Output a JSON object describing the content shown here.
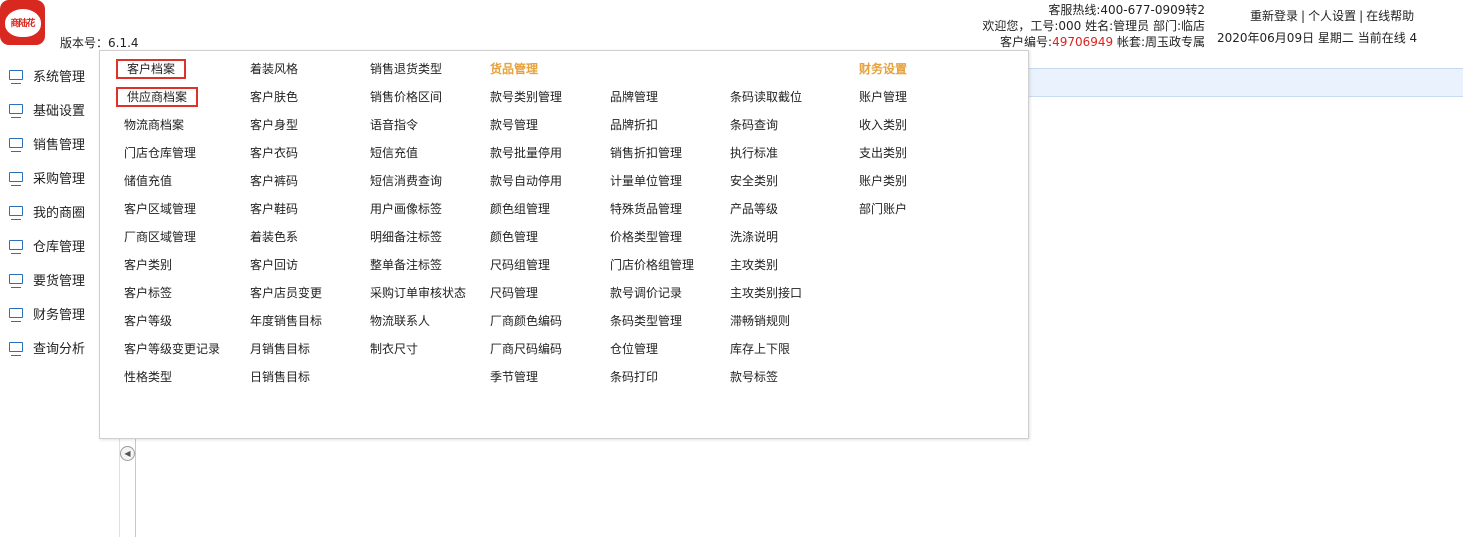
{
  "header": {
    "logo_text": "商陆花",
    "version": "版本号：6.1.4",
    "hotline": "客服热线:400-677-0909转2",
    "welcome": "欢迎您，工号:000 姓名:管理员 部门:临店",
    "customer_label": "客户编号:",
    "customer_no": "49706949",
    "account_set": " 帐套:周玉政专属",
    "links": [
      "重新登录",
      "个人设置",
      "在线帮助"
    ],
    "date_line": "2020年06月09日 星期二 当前在线 4"
  },
  "sidebar": {
    "items": [
      {
        "label": "系统管理"
      },
      {
        "label": "基础设置"
      },
      {
        "label": "销售管理"
      },
      {
        "label": "采购管理"
      },
      {
        "label": "我的商圈"
      },
      {
        "label": "仓库管理"
      },
      {
        "label": "要货管理"
      },
      {
        "label": "财务管理"
      },
      {
        "label": "查询分析"
      }
    ]
  },
  "menu": {
    "col1": [
      "客户档案",
      "供应商档案",
      "物流商档案",
      "门店仓库管理",
      "储值充值",
      "客户区域管理",
      "厂商区域管理",
      "客户类别",
      "客户标签",
      "客户等级",
      "客户等级变更记录",
      "性格类型"
    ],
    "col2": [
      "着装风格",
      "客户肤色",
      "客户身型",
      "客户衣码",
      "客户裤码",
      "客户鞋码",
      "着装色系",
      "客户回访",
      "客户店员变更",
      "年度销售目标",
      "月销售目标",
      "日销售目标"
    ],
    "col3": [
      "销售退货类型",
      "销售价格区间",
      "语音指令",
      "短信充值",
      "短信消费查询",
      "用户画像标签",
      "明细备注标签",
      "整单备注标签",
      "采购订单审核状态",
      "物流联系人",
      "制衣尺寸"
    ],
    "goods_header": "货品管理",
    "col4": [
      "款号类别管理",
      "款号管理",
      "款号批量停用",
      "款号自动停用",
      "颜色组管理",
      "颜色管理",
      "尺码组管理",
      "尺码管理",
      "厂商颜色编码",
      "厂商尺码编码",
      "季节管理"
    ],
    "col5": [
      "品牌管理",
      "品牌折扣",
      "销售折扣管理",
      "计量单位管理",
      "特殊货品管理",
      "价格类型管理",
      "门店价格组管理",
      "款号调价记录",
      "条码类型管理",
      "仓位管理",
      "条码打印"
    ],
    "col6": [
      "条码读取截位",
      "条码查询",
      "执行标准",
      "安全类别",
      "产品等级",
      "洗涤说明",
      "主攻类别",
      "主攻类别接口",
      "滞畅销规则",
      "库存上下限",
      "款号标签"
    ],
    "finance_header": "财务设置",
    "col7": [
      "账户管理",
      "收入类别",
      "支出类别",
      "账户类别",
      "部门账户"
    ],
    "highlighted": [
      "客户档案",
      "供应商档案"
    ]
  },
  "colors": {
    "accent_red": "#e0302a",
    "header_orange": "#e6a23c",
    "icon_blue": "#2d6fb7",
    "customer_no_red": "#e02020"
  }
}
